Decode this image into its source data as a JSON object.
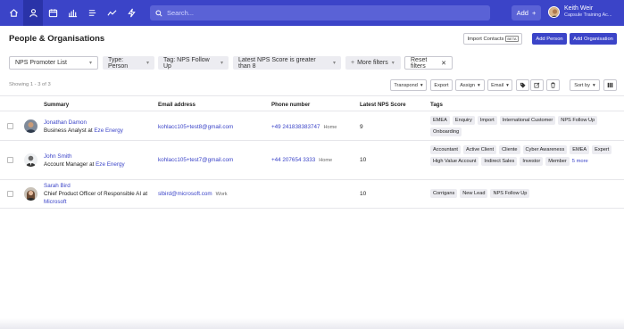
{
  "topbar": {
    "nav": [
      "home-icon",
      "person-icon",
      "calendar-icon",
      "bar-chart-icon",
      "list-icon",
      "trend-line-icon",
      "bolt-icon"
    ],
    "search_placeholder": "Search...",
    "add_label": "Add",
    "user": {
      "name": "Keith Weir",
      "org": "Capsule Training Ac..."
    }
  },
  "page": {
    "title": "People & Organisations",
    "import_label": "Import Contacts",
    "beta_label": "BETA",
    "add_person_label": "Add Person",
    "add_org_label": "Add Organisation"
  },
  "filters": {
    "list_value": "NPS Promoter List",
    "type": "Type:  Person",
    "tag": "Tag:  NPS Follow Up",
    "score": "Latest NPS Score is greater than  8",
    "more": "More filters",
    "reset": "Reset filters"
  },
  "toolbar": {
    "showing": "Showing 1 - 3 of 3",
    "transpond": "Transpond",
    "export": "Export",
    "assign": "Assign",
    "email": "Email",
    "sort": "Sort by"
  },
  "table": {
    "headers": {
      "summary": "Summary",
      "email": "Email address",
      "phone": "Phone number",
      "nps": "Latest NPS Score",
      "tags": "Tags"
    },
    "rows": [
      {
        "name": "Jonathan Damon",
        "job": "Business Analyst at",
        "org": "Eze Energy",
        "email": "kohlacc105+test8@gmail.com",
        "email_type": "",
        "phone": "+49 241838383747",
        "phone_type": "Home",
        "nps": "9",
        "tags": [
          "EMEA",
          "Enquiry",
          "Import",
          "International Customer",
          "NPS Follow Up",
          "Onboarding"
        ],
        "more": ""
      },
      {
        "name": "John Smith",
        "job": "Account Manager at",
        "org": "Eze Energy",
        "email": "kohlacc105+test7@gmail.com",
        "email_type": "",
        "phone": "+44 207654 3333",
        "phone_type": "Home",
        "nps": "10",
        "tags": [
          "Accountant",
          "Active Client",
          "Cliente",
          "Cyber Awareness",
          "EMEA",
          "Expert",
          "High Value Account",
          "Indirect Sales",
          "Investor",
          "Member"
        ],
        "more": "5 more"
      },
      {
        "name": "Sarah Bird",
        "job": "Chief Product Officer of Responsible AI at",
        "org": "Microsoft",
        "email": "slbird@microsoft.com",
        "email_type": "Work",
        "phone": "",
        "phone_type": "",
        "nps": "10",
        "tags": [
          "Corrigans",
          "New Lead",
          "NPS Follow Up"
        ],
        "more": ""
      }
    ]
  }
}
